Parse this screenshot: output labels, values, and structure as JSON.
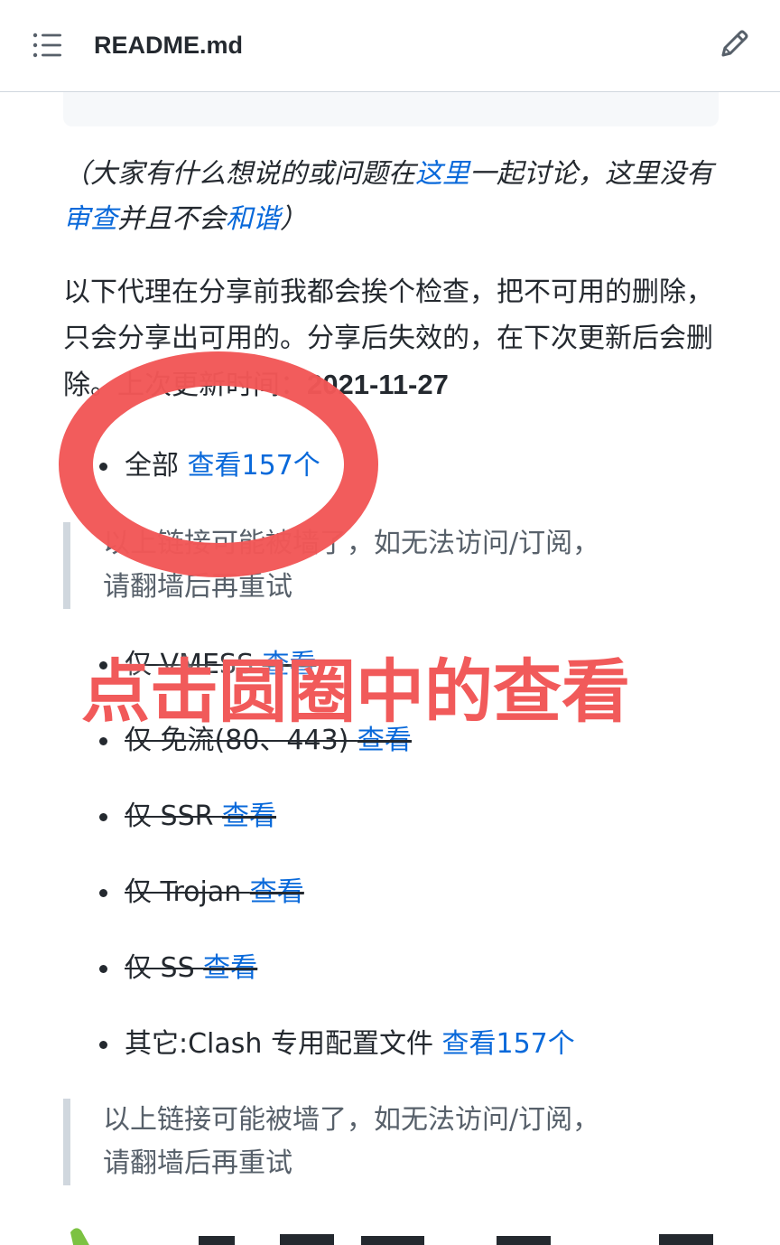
{
  "header": {
    "title": "README.md",
    "menu_icon": "list-icon",
    "edit_icon": "pencil-icon"
  },
  "note": {
    "part1": "（大家有什么想说的或问题在",
    "link1": "这里",
    "part2": "一起讨论，这里没有",
    "link2": "审查",
    "part3": "并且不会",
    "link3": "和谐",
    "part4": "）"
  },
  "intro": {
    "text": "以下代理在分享前我都会挨个检查，把不可用的删除，只会分享出可用的。分享后失效的，在下次更新后会删除。上次更新时间：",
    "date": "2021-11-27"
  },
  "list": [
    {
      "label": "全部 ",
      "link": "查看157个",
      "struck": false
    },
    {
      "label": "仅 VMESS ",
      "link": "查看",
      "struck": true
    },
    {
      "label": "仅 免流(80、443) ",
      "link": "查看",
      "struck": true
    },
    {
      "label": "仅 SSR ",
      "link": "查看",
      "struck": true
    },
    {
      "label": "仅 Trojan ",
      "link": "查看",
      "struck": true
    },
    {
      "label": "仅 SS ",
      "link": "查看",
      "struck": true
    },
    {
      "label": "其它:Clash 专用配置文件 ",
      "link": "查看157个",
      "struck": false
    }
  ],
  "quote": {
    "line1": "以上链接可能被墙了，如无法访问/订阅，",
    "line2": "请翻墙后再重试"
  },
  "annotation": {
    "text": "点击圆圈中的查看",
    "color": "#f15a5a"
  },
  "colors": {
    "link": "#0969da",
    "text": "#24292f",
    "quote_border": "#d0d7de"
  }
}
